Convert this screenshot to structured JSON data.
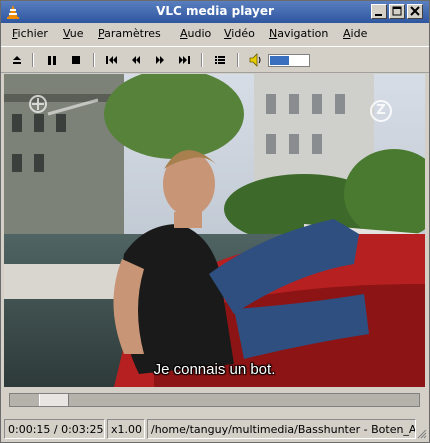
{
  "window": {
    "title": "VLC media player"
  },
  "menu": {
    "items": [
      {
        "u": "F",
        "rest": "ichier"
      },
      {
        "u": "V",
        "rest": "ue"
      },
      {
        "u": "P",
        "rest": "aramètres"
      },
      {
        "u": "A",
        "rest": "udio"
      },
      {
        "u": "V",
        "rest": "idéo"
      },
      {
        "u": "N",
        "rest": "avigation"
      },
      {
        "u": "A",
        "rest": "ide"
      }
    ]
  },
  "toolbar": {
    "buttons": [
      "eject-icon",
      "pause-icon",
      "stop-icon",
      "skip-previous-icon",
      "rewind-icon",
      "fast-forward-icon",
      "skip-next-icon",
      "playlist-icon",
      "volume-icon"
    ],
    "volume_level": 0.5
  },
  "video": {
    "subtitle": "Je connais un bot.",
    "overlay_logo_right": "Z"
  },
  "seek": {
    "position": 0.076
  },
  "status": {
    "time": "0:00:15 / 0:03:25",
    "speed": "x1.00",
    "path": "/home/tanguy/multimedia/Basshunter - Boten_Anna"
  },
  "colors": {
    "titlebar": "#3a64ad",
    "accent": "#3a6fbf"
  }
}
